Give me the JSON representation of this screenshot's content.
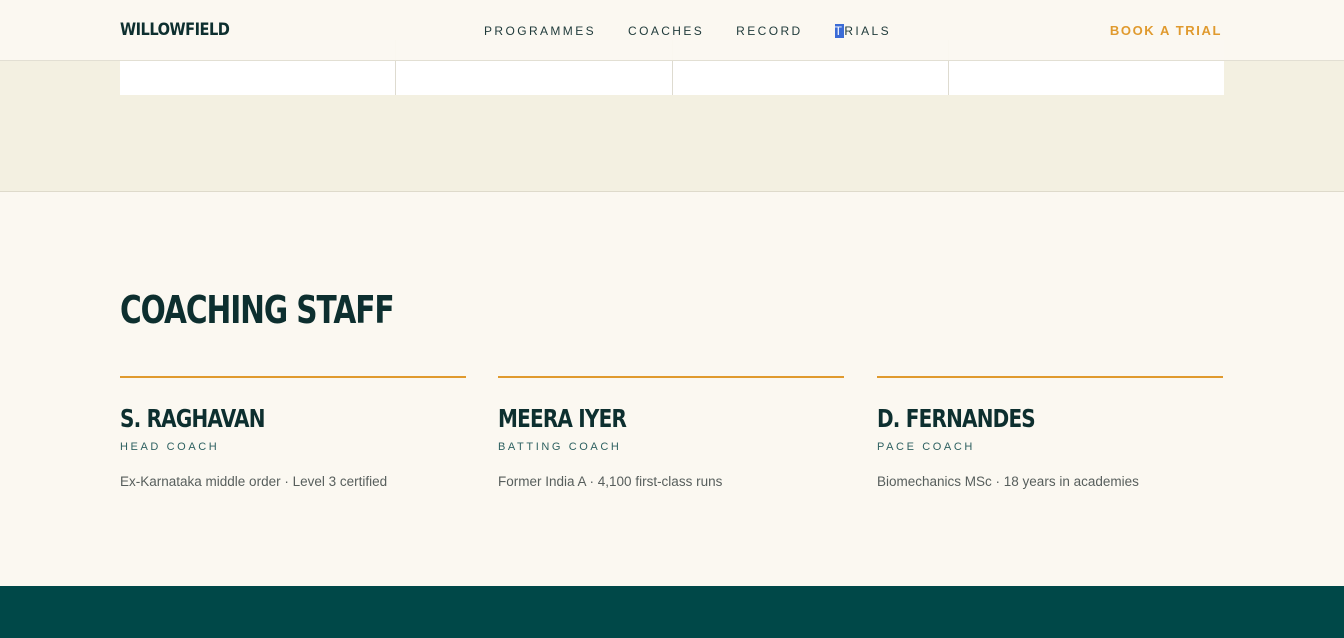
{
  "header": {
    "logo": "WILLOWFIELD",
    "nav": [
      {
        "label": "PROGRAMMES"
      },
      {
        "label": "COACHES"
      },
      {
        "label": "RECORD"
      },
      {
        "label_first": "T",
        "label_rest": "RIALS"
      }
    ],
    "cta": "BOOK A TRIAL"
  },
  "staff": {
    "title": "COACHING STAFF",
    "coaches": [
      {
        "name": "S. RAGHAVAN",
        "role": "HEAD COACH",
        "bio": "Ex-Karnataka middle order · Level 3 certified"
      },
      {
        "name": "MEERA IYER",
        "role": "BATTING COACH",
        "bio": "Former India A · 4,100 first-class runs"
      },
      {
        "name": "D. FERNANDES",
        "role": "PACE COACH",
        "bio": "Biomechanics MSc · 18 years in academies"
      }
    ]
  },
  "colors": {
    "accent": "#e09a2e",
    "ink": "#0d2f2f",
    "footer": "#004848",
    "page": "#fbf8f1",
    "band": "#f3f0e1"
  }
}
